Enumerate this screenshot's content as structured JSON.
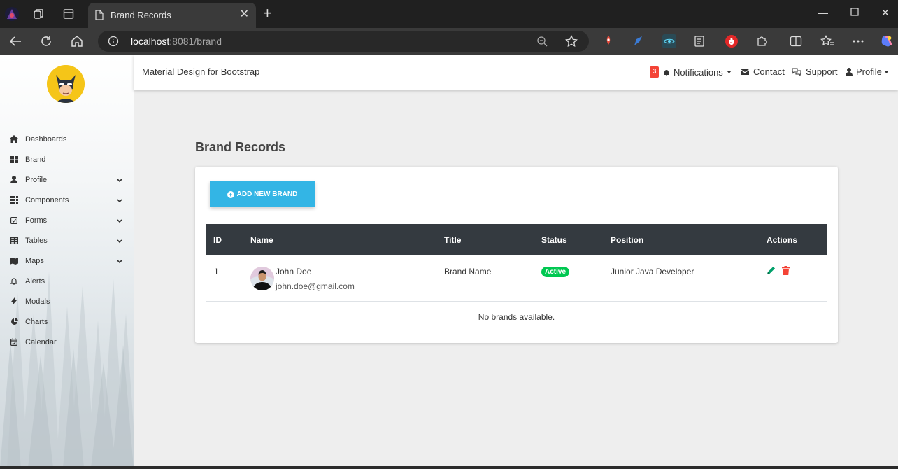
{
  "browser": {
    "tab_title": "Brand Records",
    "url_host": "localhost",
    "url_rest": ":8081/brand"
  },
  "navbar": {
    "brand": "Material Design for Bootstrap",
    "notif_count": "3",
    "notifications": "Notifications",
    "contact": "Contact",
    "support": "Support",
    "profile": "Profile"
  },
  "sidebar": {
    "items": [
      {
        "label": "Dashboards",
        "icon": "home-icon"
      },
      {
        "label": "Brand",
        "icon": "grid-icon"
      },
      {
        "label": "Profile",
        "icon": "user-icon"
      },
      {
        "label": "Components",
        "icon": "th-icon"
      },
      {
        "label": "Forms",
        "icon": "check-square-icon"
      },
      {
        "label": "Tables",
        "icon": "table-icon"
      },
      {
        "label": "Maps",
        "icon": "map-icon"
      },
      {
        "label": "Alerts",
        "icon": "bell-icon"
      },
      {
        "label": "Modals",
        "icon": "bolt-icon"
      },
      {
        "label": "Charts",
        "icon": "pie-chart-icon"
      },
      {
        "label": "Calendar",
        "icon": "calendar-icon"
      }
    ]
  },
  "main": {
    "title": "Brand Records",
    "add_button": "ADD NEW BRAND",
    "columns": [
      "ID",
      "Name",
      "Title",
      "Status",
      "Position",
      "Actions"
    ],
    "rows": [
      {
        "id": "1",
        "name": "John Doe",
        "email": "john.doe@gmail.com",
        "title": "Brand Name",
        "status": "Active",
        "position": "Junior Java Developer"
      }
    ],
    "empty_text": "No brands available."
  },
  "colors": {
    "accent": "#33b5e5",
    "table_header": "#343a40",
    "active": "#00c851",
    "danger": "#f44336"
  }
}
